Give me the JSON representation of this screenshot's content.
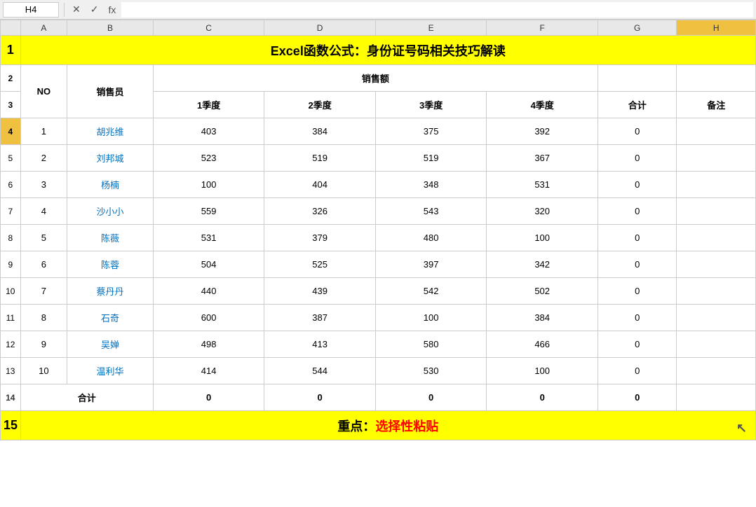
{
  "formulaBar": {
    "cellRef": "H4",
    "icons": [
      "✕",
      "✓",
      "fx"
    ]
  },
  "title": "Excel函数公式：身份证号码相关技巧解读",
  "headers": {
    "no": "NO",
    "salesperson": "销售员",
    "salesAmount": "销售额",
    "q1": "1季度",
    "q2": "2季度",
    "q3": "3季度",
    "q4": "4季度",
    "total": "合计",
    "notes": "备注"
  },
  "rows": [
    {
      "no": "1",
      "name": "胡兆维",
      "q1": "403",
      "q2": "384",
      "q3": "375",
      "q4": "392",
      "total": "0"
    },
    {
      "no": "2",
      "name": "刘邦城",
      "q1": "523",
      "q2": "519",
      "q3": "519",
      "q4": "367",
      "total": "0"
    },
    {
      "no": "3",
      "name": "杨楠",
      "q1": "100",
      "q2": "404",
      "q3": "348",
      "q4": "531",
      "total": "0"
    },
    {
      "no": "4",
      "name": "沙小小",
      "q1": "559",
      "q2": "326",
      "q3": "543",
      "q4": "320",
      "total": "0"
    },
    {
      "no": "5",
      "name": "陈薇",
      "q1": "531",
      "q2": "379",
      "q3": "480",
      "q4": "100",
      "total": "0"
    },
    {
      "no": "6",
      "name": "陈蓉",
      "q1": "504",
      "q2": "525",
      "q3": "397",
      "q4": "342",
      "total": "0"
    },
    {
      "no": "7",
      "name": "蔡丹丹",
      "q1": "440",
      "q2": "439",
      "q3": "542",
      "q4": "502",
      "total": "0"
    },
    {
      "no": "8",
      "name": "石奇",
      "q1": "600",
      "q2": "387",
      "q3": "100",
      "q4": "384",
      "total": "0"
    },
    {
      "no": "9",
      "name": "吴婵",
      "q1": "498",
      "q2": "413",
      "q3": "580",
      "q4": "466",
      "total": "0"
    },
    {
      "no": "10",
      "name": "温利华",
      "q1": "414",
      "q2": "544",
      "q3": "530",
      "q4": "100",
      "total": "0"
    }
  ],
  "summary": {
    "label": "合计",
    "q1": "0",
    "q2": "0",
    "q3": "0",
    "q4": "0",
    "total": "0"
  },
  "bottomText": {
    "prefix": "重点：",
    "highlight": "选择性粘贴"
  },
  "colLabels": [
    "A",
    "B",
    "C",
    "D",
    "E",
    "F",
    "G",
    "H"
  ]
}
